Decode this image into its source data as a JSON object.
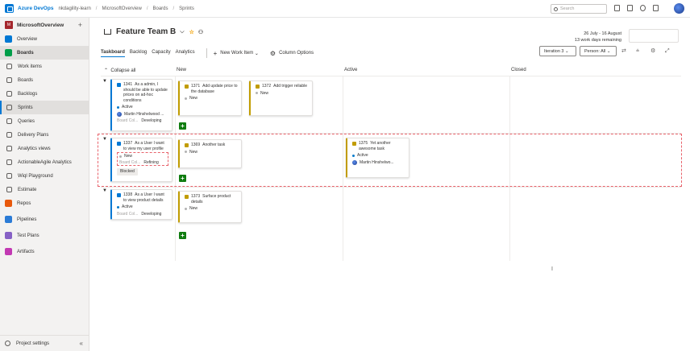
{
  "topbar": {
    "brand": "Azure DevOps",
    "breadcrumbs": [
      "nkdagility-learn",
      "MicrosoftOverview",
      "Boards",
      "Sprints"
    ],
    "search_placeholder": "Search"
  },
  "sidebar": {
    "org_badge": "M",
    "org_name": "MicrosoftOverview",
    "plus": "+",
    "items": [
      {
        "label": "Overview",
        "color": "#0078d4"
      },
      {
        "label": "Boards",
        "color": "#009e49"
      },
      {
        "label": "Work items",
        "color": ""
      },
      {
        "label": "Boards",
        "color": ""
      },
      {
        "label": "Backlogs",
        "color": ""
      },
      {
        "label": "Sprints",
        "color": ""
      },
      {
        "label": "Queries",
        "color": ""
      },
      {
        "label": "Delivery Plans",
        "color": ""
      },
      {
        "label": "Analytics views",
        "color": ""
      },
      {
        "label": "ActionableAgile Analytics",
        "color": ""
      },
      {
        "label": "Wiql Playground",
        "color": ""
      },
      {
        "label": "Estimate",
        "color": ""
      },
      {
        "label": "Repos",
        "color": "#e8590c"
      },
      {
        "label": "Pipelines",
        "color": "#2b7bd6"
      },
      {
        "label": "Test Plans",
        "color": "#8661c5"
      },
      {
        "label": "Artifacts",
        "color": "#c239b3"
      }
    ],
    "project_settings": "Project settings",
    "collapse_glyph": "«"
  },
  "header": {
    "title": "Feature Team B",
    "title_chevron": "⌵",
    "star": "☆",
    "team_glyph": "⚇",
    "date_range": "26 July - 16 August",
    "days_remaining": "13 work days remaining"
  },
  "tabs": [
    "Taskboard",
    "Backlog",
    "Capacity",
    "Analytics"
  ],
  "toolbar": {
    "new_work_item": "New Work Item",
    "new_work_item_glyph": "+",
    "new_work_item_caret": "⌄",
    "column_options": "Column Options",
    "column_options_glyph": "⚙",
    "iteration": "Iteration 3",
    "iteration_caret": "⌄",
    "person": "Person: All",
    "person_caret": "⌄",
    "tool_glyphs": [
      "⇄",
      "⩮",
      "⚙",
      "⤢"
    ]
  },
  "board": {
    "collapse_all": "Collapse all",
    "collapse_glyph": "⌃",
    "row_chevron": "▼",
    "add_glyph": "+",
    "columns": [
      "New",
      "Active",
      "Closed"
    ],
    "rows": [
      {
        "story": {
          "id": "1341",
          "title": "As a admin, I should be able to update prices on ad-hoc conditions",
          "state": "Active",
          "assignee": "Martin Hinshelwood ...",
          "field_label": "Board Col...",
          "field_value": "Developing"
        },
        "tasks": [
          {
            "id": "1371",
            "title": "Add update price to the database",
            "state": "New"
          },
          {
            "id": "1372",
            "title": "Add trigger reliable",
            "state": "New"
          }
        ]
      },
      {
        "story": {
          "id": "1337",
          "title": "As a User I want to view my user profile",
          "state": "New",
          "field_label": "Board Col...",
          "field_value": "Refining",
          "tag": "Blocked"
        },
        "tasks": [
          {
            "id": "1369",
            "title": "Another task",
            "state": "New"
          },
          {
            "id": "1375",
            "title": "Yet another awesome task",
            "state": "Active",
            "assignee": "Martin Hinshelwo..."
          }
        ]
      },
      {
        "story": {
          "id": "1338",
          "title": "As a User I want to view product details",
          "state": "Active",
          "field_label": "Board Col...",
          "field_value": "Developing"
        },
        "tasks": [
          {
            "id": "1373",
            "title": "Surface product details",
            "state": "New"
          }
        ]
      }
    ]
  },
  "cursor": "I"
}
